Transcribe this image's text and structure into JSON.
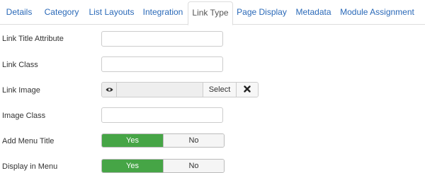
{
  "tabs": [
    {
      "label": "Details"
    },
    {
      "label": "Category"
    },
    {
      "label": "List Layouts"
    },
    {
      "label": "Integration"
    },
    {
      "label": "Link Type",
      "active": true
    },
    {
      "label": "Page Display"
    },
    {
      "label": "Metadata"
    },
    {
      "label": "Module Assignment"
    }
  ],
  "form": {
    "link_title_attribute": {
      "label": "Link Title Attribute",
      "value": ""
    },
    "link_class": {
      "label": "Link Class",
      "value": ""
    },
    "link_image": {
      "label": "Link Image",
      "value": "",
      "select_label": "Select",
      "preview_icon": "eye-icon",
      "clear_icon": "close-icon"
    },
    "image_class": {
      "label": "Image Class",
      "value": ""
    },
    "add_menu_title": {
      "label": "Add Menu Title",
      "yes_label": "Yes",
      "no_label": "No",
      "selected": "Yes"
    },
    "display_in_menu": {
      "label": "Display in Menu",
      "yes_label": "Yes",
      "no_label": "No",
      "selected": "Yes"
    }
  },
  "colors": {
    "tab_link": "#2a69b8",
    "active_yes": "#46a546"
  }
}
